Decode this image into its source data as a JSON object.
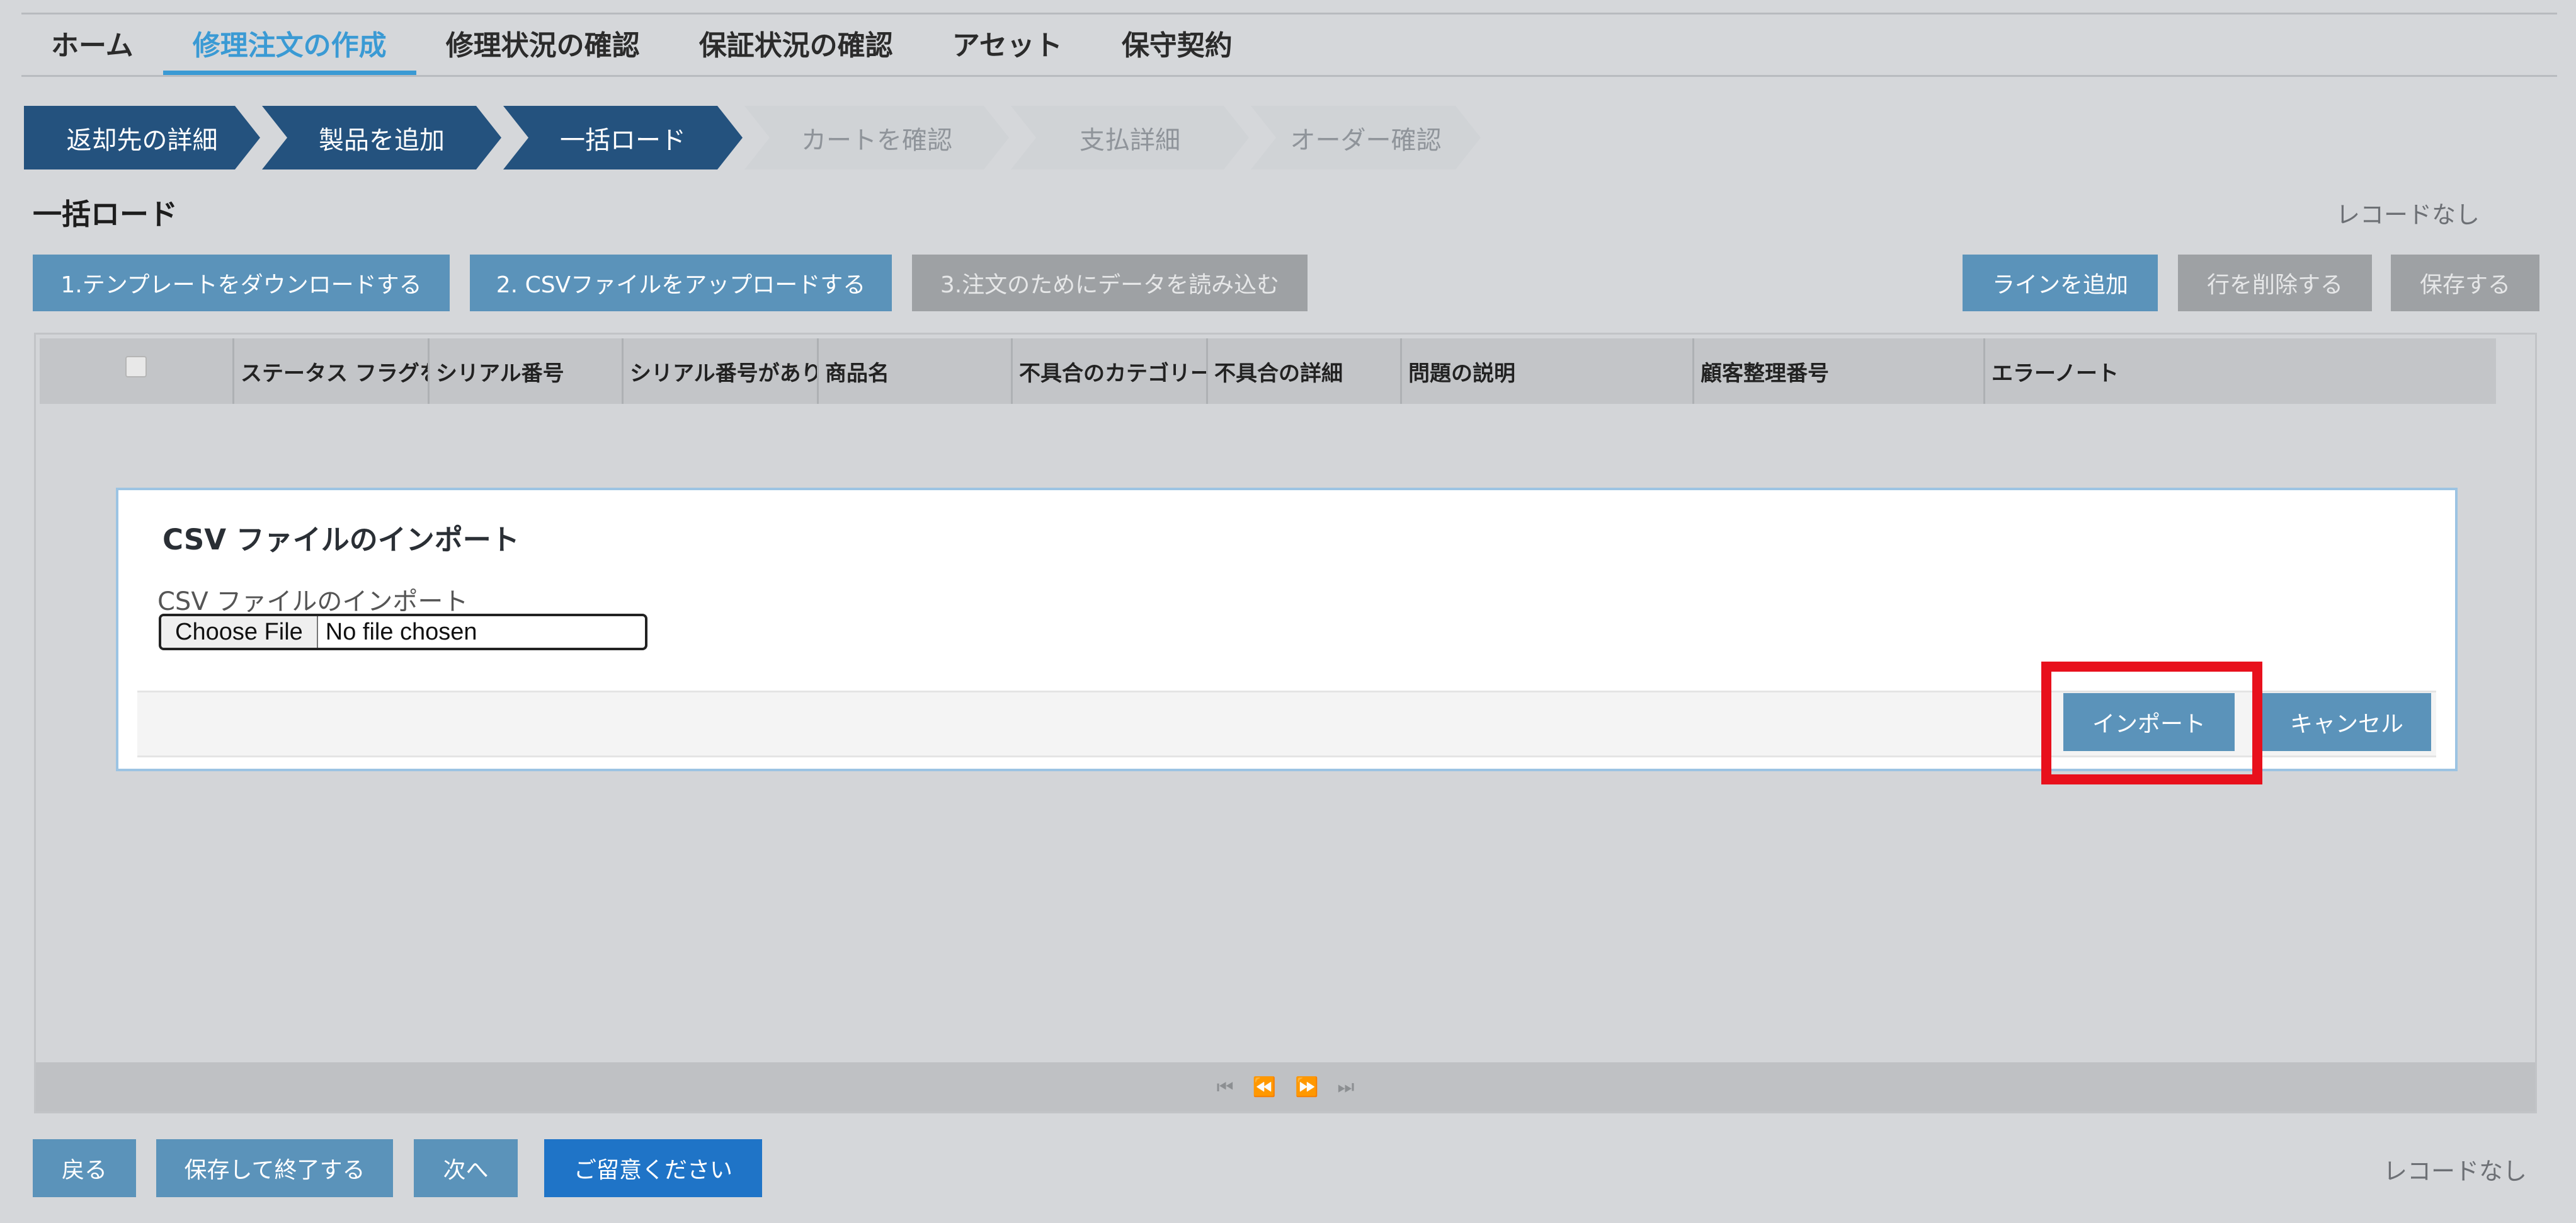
{
  "nav": {
    "items": [
      "ホーム",
      "修理注文の作成",
      "修理状況の確認",
      "保証状況の確認",
      "アセット",
      "保守契約"
    ],
    "active_index": 1
  },
  "stepper": {
    "steps": [
      {
        "label": "返却先の詳細",
        "state": "done"
      },
      {
        "label": "製品を追加",
        "state": "done"
      },
      {
        "label": "一括ロード",
        "state": "done"
      },
      {
        "label": "カートを確認",
        "state": "todo"
      },
      {
        "label": "支払詳細",
        "state": "todo"
      },
      {
        "label": "オーダー確認",
        "state": "todo"
      }
    ]
  },
  "section": {
    "title": "一括ロード",
    "record_count_text": "レコードなし"
  },
  "toolbar": {
    "download_template": "1.テンプレートをダウンロードする",
    "upload_csv": "2. CSVファイルをアップロードする",
    "load_data": "3.注文のためにデータを読み込む",
    "add_line": "ラインを追加",
    "delete_row": "行を削除する",
    "save": "保存する"
  },
  "grid": {
    "columns": [
      "ステータス フラグを",
      "シリアル番号",
      "シリアル番号があり",
      "商品名",
      "不具合のカテゴリー",
      "不具合の詳細",
      "問題の説明",
      "顧客整理番号",
      "エラーノート"
    ],
    "pager": [
      "⏮",
      "⏪",
      "⏩",
      "⏭"
    ]
  },
  "modal": {
    "title": "CSV ファイルのインポート",
    "field_label": "CSV ファイルのインポート",
    "file_button": "Choose File",
    "file_status": "No file chosen",
    "import_label": "インポート",
    "cancel_label": "キャンセル"
  },
  "footer": {
    "back": "戻る",
    "save_exit": "保存して終了する",
    "next": "次へ",
    "notice": "ご留意ください",
    "record_count_text": "レコードなし"
  },
  "colors": {
    "accent": "#3a9ad4",
    "step_done": "#24527e",
    "button_blue": "#5b93ba",
    "button_dark": "#1f74c7",
    "highlight": "#e8101c"
  }
}
